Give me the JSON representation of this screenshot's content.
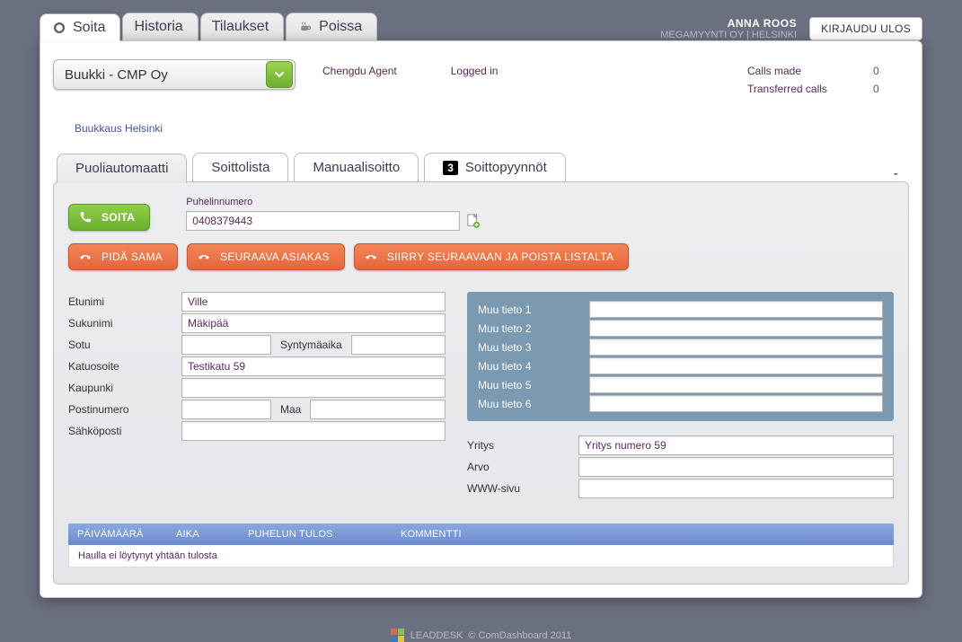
{
  "user": {
    "name": "ANNA ROOS",
    "org": "MEGAMYYNTI OY | HELSINKI",
    "logout": "KIRJAUDU ULOS"
  },
  "top_tabs": {
    "call": "Soita",
    "history": "Historia",
    "orders": "Tilaukset",
    "away": "Poissa"
  },
  "company": {
    "selected": "Buukki - CMP Oy",
    "campaign": "Buukkaus Helsinki"
  },
  "agent": {
    "name": "Chengdu Agent",
    "status": "Logged in"
  },
  "stats": {
    "calls_made_label": "Calls made",
    "calls_made": "0",
    "transferred_label": "Transferred calls",
    "transferred": "0"
  },
  "sub_tabs": {
    "semi": "Puoliautomaatti",
    "calllist": "Soittolista",
    "manual": "Manuaalisoitto",
    "requests_badge": "3",
    "requests": "Soittopyynnöt"
  },
  "buttons": {
    "call": "SOITA",
    "keep": "PIDÄ SAMA",
    "next": "SEURAAVA ASIAKAS",
    "skip": "SIIRRY SEURAAVAAN JA POISTA LISTALTA"
  },
  "phone": {
    "label": "Puhelinnumero",
    "value": "0408379443"
  },
  "labels": {
    "first": "Etunimi",
    "last": "Sukunimi",
    "ssn": "Sotu",
    "dob": "Syntymäaika",
    "street": "Katuosoite",
    "city": "Kaupunki",
    "postal": "Postinumero",
    "country": "Maa",
    "email": "Sähköposti"
  },
  "values": {
    "first": "Ville",
    "last": "Mäkipää",
    "ssn": "",
    "dob": "",
    "street": "Testikatu 59",
    "city": "",
    "postal": "",
    "country": "",
    "email": ""
  },
  "muu": {
    "l1": "Muu tieto 1",
    "l2": "Muu tieto 2",
    "l3": "Muu tieto 3",
    "l4": "Muu tieto 4",
    "l5": "Muu tieto 5",
    "l6": "Muu tieto 6",
    "v1": "",
    "v2": "",
    "v3": "",
    "v4": "",
    "v5": "",
    "v6": ""
  },
  "company_fields": {
    "company_l": "Yritys",
    "company_v": "Yritys numero 59",
    "value_l": "Arvo",
    "value_v": "",
    "www_l": "WWW-sivu",
    "www_v": ""
  },
  "history": {
    "date": "PÄIVÄMÄÄRÄ",
    "time": "AIKA",
    "result": "PUHELUN TULOS",
    "comment": "KOMMENTTI",
    "empty": "Haulla ei löytynyt yhtään tulosta"
  },
  "footer": {
    "brand": "LEADDESK",
    "copy": "© ComDashboard 2011"
  }
}
